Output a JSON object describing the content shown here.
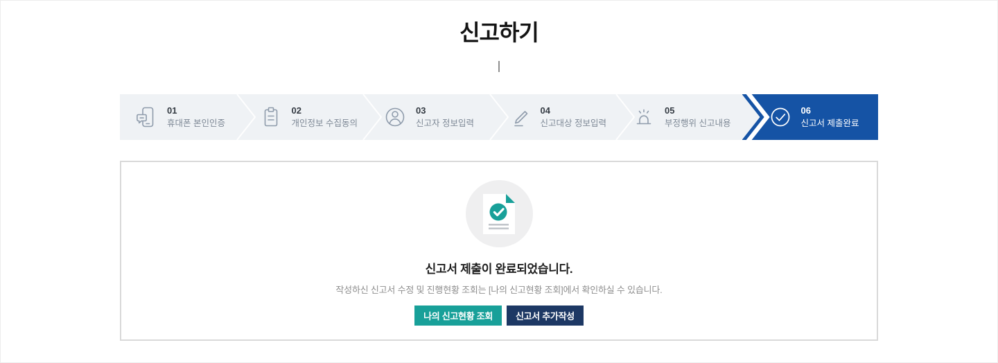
{
  "page": {
    "title": "신고하기"
  },
  "steps": {
    "items": [
      {
        "number": "01",
        "label": "휴대폰 본인인증",
        "icon": "phone-auth-icon",
        "active": false
      },
      {
        "number": "02",
        "label": "개인정보 수집동의",
        "icon": "clipboard-icon",
        "active": false
      },
      {
        "number": "03",
        "label": "신고자 정보입력",
        "icon": "user-icon",
        "active": false
      },
      {
        "number": "04",
        "label": "신고대상 정보입력",
        "icon": "pencil-icon",
        "active": false
      },
      {
        "number": "05",
        "label": "부정행위 신고내용",
        "icon": "siren-icon",
        "active": false
      },
      {
        "number": "06",
        "label": "신고서 제출완료",
        "icon": "check-circle-icon",
        "active": true
      }
    ]
  },
  "result": {
    "heading": "신고서 제출이 완료되었습니다.",
    "description": "작성하신 신고서 수정 및 진행현황 조회는 [나의 신고현황 조회]에서 확인하실 수 있습니다.",
    "icon": "document-check-icon",
    "buttons": [
      {
        "label": "나의 신고현황 조회",
        "style": "teal"
      },
      {
        "label": "신고서 추가작성",
        "style": "navy"
      }
    ]
  },
  "colors": {
    "active_step_blue": "#1553a5",
    "stepbar_bg": "#eff2f5",
    "teal": "#18a099",
    "navy": "#1d3864",
    "panel_border": "#d9d9d9",
    "icon_gray": "#8e9bab"
  }
}
